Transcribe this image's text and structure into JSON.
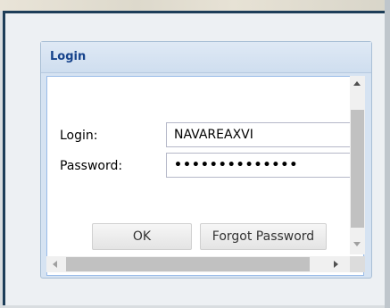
{
  "login_window": {
    "title": "Login",
    "login_label": "Login:",
    "login_value": "NAVAREAXVI",
    "password_label": "Password:",
    "password_value": "••••••••••••••",
    "ok_button": "OK",
    "forgot_button": "Forgot Password"
  },
  "icons": {
    "scroll_up": "chevron-up-icon",
    "scroll_down": "chevron-down-icon",
    "scroll_left": "chevron-left-icon",
    "scroll_right": "chevron-right-icon"
  }
}
